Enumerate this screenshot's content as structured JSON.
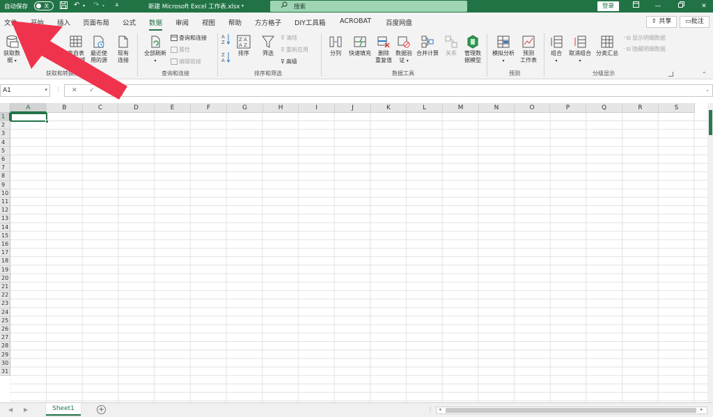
{
  "titlebar": {
    "autosave_label": "自动保存",
    "autosave_state": "关",
    "doc_title": "新建 Microsoft Excel 工作表.xlsx",
    "search_placeholder": "搜索",
    "login_label": "登录",
    "accent_color": "#217346"
  },
  "tabs": [
    {
      "label": "文件"
    },
    {
      "label": "开始"
    },
    {
      "label": "插入"
    },
    {
      "label": "页面布局"
    },
    {
      "label": "公式"
    },
    {
      "label": "数据",
      "active": true
    },
    {
      "label": "审阅"
    },
    {
      "label": "视图"
    },
    {
      "label": "帮助"
    },
    {
      "label": "方方格子"
    },
    {
      "label": "DIY工具箱"
    },
    {
      "label": "ACROBAT"
    },
    {
      "label": "百度网盘"
    }
  ],
  "tabbar": {
    "share_label": "共享",
    "comment_label": "批注"
  },
  "ribbon": {
    "get_data": {
      "line1": "获取数",
      "line2": "据",
      "from_text_partial": "本",
      "from_table_line1": "来自表",
      "from_table_line2": "格/区域",
      "recent_line1": "最近使",
      "recent_line2": "用的源",
      "existing_line1": "现有",
      "existing_line2": "连接",
      "group_label": "获取和转换数据"
    },
    "queries": {
      "refresh_all": "全部刷新",
      "queries_connections": "查询和连接",
      "properties": "属性",
      "edit_links": "编辑链接",
      "group_label": "查询和连接"
    },
    "sort_filter": {
      "sort": "排序",
      "filter": "筛选",
      "clear": "清除",
      "reapply": "重新应用",
      "advanced": "高级",
      "group_label": "排序和筛选"
    },
    "data_tools": {
      "text_to_columns": "分列",
      "flash_fill": "快速填充",
      "remove_dup_line1": "删除",
      "remove_dup_line2": "重复值",
      "validation_line1": "数据验",
      "validation_line2": "证",
      "consolidate": "合并计算",
      "relationships": "关系",
      "model_line1": "管理数",
      "model_line2": "据模型",
      "group_label": "数据工具"
    },
    "forecast": {
      "what_if": "模拟分析",
      "sheet_line1": "预测",
      "sheet_line2": "工作表",
      "group_label": "预测"
    },
    "outline": {
      "group": "组合",
      "ungroup": "取消组合",
      "subtotal": "分类汇总",
      "show_detail": "显示明细数据",
      "hide_detail": "隐藏明细数据",
      "group_label": "分级显示"
    }
  },
  "formula_bar": {
    "name_box": "A1",
    "cancel": "✕",
    "enter": "✓",
    "fx": "fx",
    "content": ""
  },
  "columns": [
    "A",
    "B",
    "C",
    "D",
    "E",
    "F",
    "G",
    "H",
    "I",
    "J",
    "K",
    "L",
    "M",
    "N",
    "O",
    "P",
    "Q",
    "R",
    "S"
  ],
  "rows": [
    "1",
    "2",
    "3",
    "4",
    "5",
    "6",
    "7",
    "8",
    "9",
    "10",
    "11",
    "12",
    "13",
    "14",
    "15",
    "16",
    "17",
    "18",
    "19",
    "20",
    "21",
    "22",
    "23",
    "24",
    "25",
    "26",
    "27",
    "28",
    "29",
    "30",
    "31"
  ],
  "selected_cell": "A1",
  "sheet": {
    "tab_label": "Sheet1",
    "add_label": "+"
  },
  "annotation": {
    "color": "#f0334d"
  }
}
